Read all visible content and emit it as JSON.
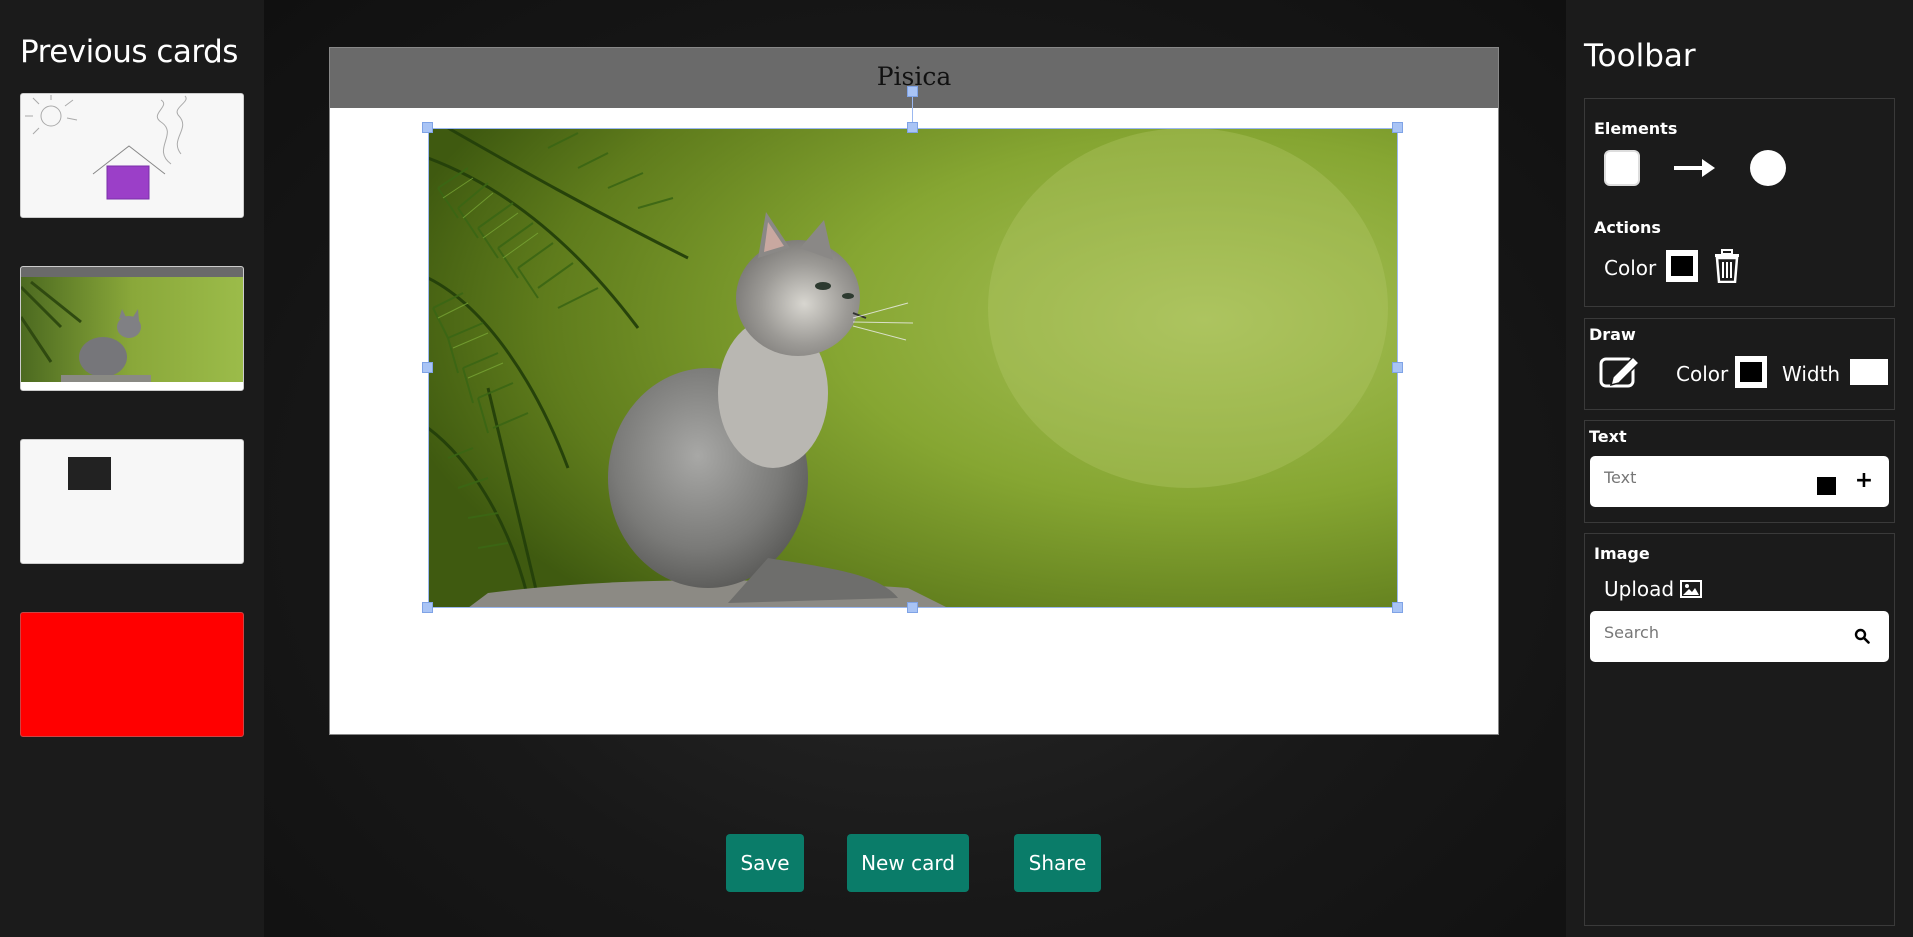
{
  "sidebar": {
    "title": "Previous cards",
    "cards": [
      "card-house-drawing",
      "card-kitten-photo",
      "card-dark-square",
      "card-red"
    ]
  },
  "card": {
    "title": "Pisica"
  },
  "actions": {
    "save_label": "Save",
    "new_card_label": "New card",
    "share_label": "Share"
  },
  "toolbar": {
    "title": "Toolbar",
    "elements": {
      "title": "Elements",
      "tools": [
        "rectangle-icon",
        "arrow-icon",
        "circle-icon"
      ]
    },
    "actions": {
      "title": "Actions",
      "color_label": "Color",
      "color_value": "#000000"
    },
    "draw": {
      "title": "Draw",
      "color_label": "Color",
      "color_value": "#000000",
      "width_label": "Width",
      "width_value": ""
    },
    "text": {
      "title": "Text",
      "placeholder": "Text",
      "color_value": "#000000"
    },
    "image": {
      "title": "Image",
      "upload_label": "Upload",
      "search_placeholder": "Search"
    }
  },
  "colors": {
    "button_bg": "#0a7c69",
    "header_bg": "#6a6a6a",
    "selection": "#a9c4f5",
    "red_card": "#ff0000",
    "house_fill": "#9b3fc8"
  }
}
